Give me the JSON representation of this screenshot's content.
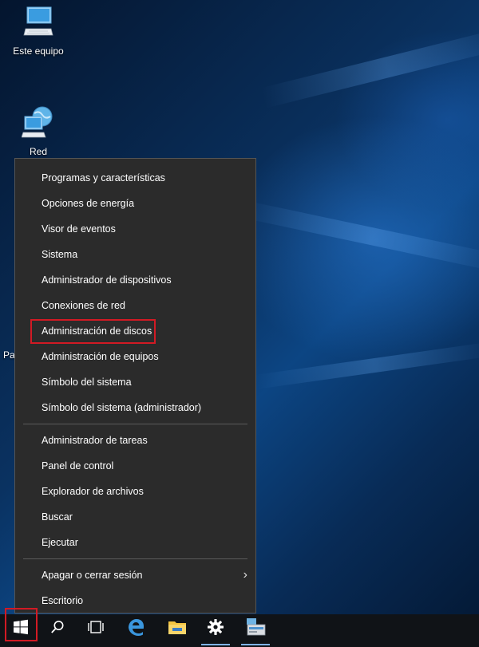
{
  "desktop": {
    "icons": [
      {
        "label": "Este equipo",
        "icon": "computer-icon"
      },
      {
        "label": "Red",
        "icon": "network-icon"
      }
    ],
    "partial_label": "Pa"
  },
  "menu": {
    "group1": [
      "Programas y características",
      "Opciones de energía",
      "Visor de eventos",
      "Sistema",
      "Administrador de dispositivos",
      "Conexiones de red",
      "Administración de discos",
      "Administración de equipos",
      "Símbolo del sistema",
      "Símbolo del sistema (administrador)"
    ],
    "group2": [
      "Administrador de tareas",
      "Panel de control",
      "Explorador de archivos",
      "Buscar",
      "Ejecutar"
    ],
    "group3": [
      "Apagar o cerrar sesión",
      "Escritorio"
    ],
    "highlighted": "Administración de discos"
  },
  "taskbar": {
    "items": [
      "start-icon",
      "search-icon",
      "task-view-icon",
      "edge-icon",
      "file-explorer-icon",
      "settings-icon",
      "server-manager-icon"
    ]
  },
  "colors": {
    "highlight": "#d21a24",
    "menu_bg": "#2b2b2b",
    "taskbar_bg": "#101317"
  }
}
